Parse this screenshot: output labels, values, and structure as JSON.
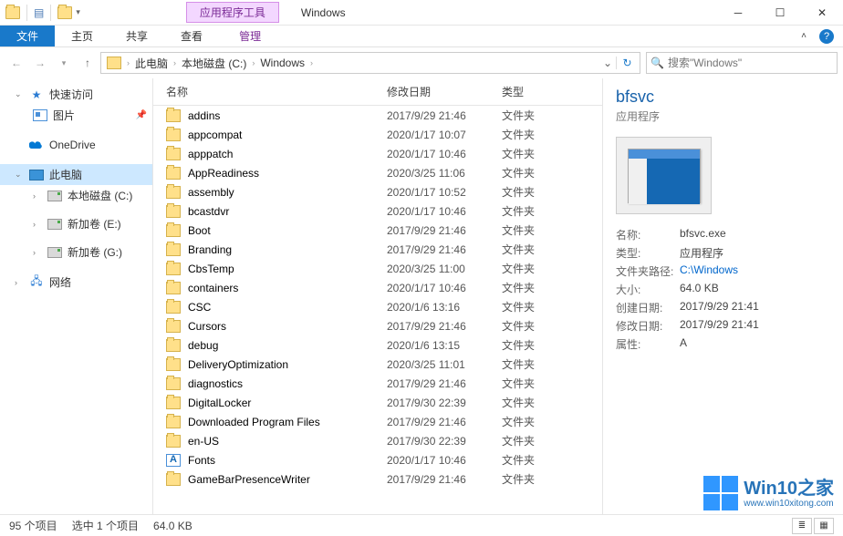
{
  "titlebar": {
    "tooltab": "应用程序工具",
    "title": "Windows"
  },
  "ribbon": {
    "file": "文件",
    "tabs": [
      "主页",
      "共享",
      "查看"
    ],
    "tooltab": "管理"
  },
  "breadcrumbs": [
    "此电脑",
    "本地磁盘 (C:)",
    "Windows"
  ],
  "search_placeholder": "搜索\"Windows\"",
  "sidebar": {
    "quick": "快速访问",
    "pictures": "图片",
    "onedrive": "OneDrive",
    "thispc": "此电脑",
    "drive_c": "本地磁盘 (C:)",
    "drive_e": "新加卷 (E:)",
    "drive_g": "新加卷 (G:)",
    "network": "网络"
  },
  "columns": {
    "name": "名称",
    "date": "修改日期",
    "type": "类型"
  },
  "files": [
    {
      "name": "addins",
      "date": "2017/9/29 21:46",
      "type": "文件夹",
      "icon": "folder"
    },
    {
      "name": "appcompat",
      "date": "2020/1/17 10:07",
      "type": "文件夹",
      "icon": "folder"
    },
    {
      "name": "apppatch",
      "date": "2020/1/17 10:46",
      "type": "文件夹",
      "icon": "folder"
    },
    {
      "name": "AppReadiness",
      "date": "2020/3/25 11:06",
      "type": "文件夹",
      "icon": "folder"
    },
    {
      "name": "assembly",
      "date": "2020/1/17 10:52",
      "type": "文件夹",
      "icon": "folder"
    },
    {
      "name": "bcastdvr",
      "date": "2020/1/17 10:46",
      "type": "文件夹",
      "icon": "folder"
    },
    {
      "name": "Boot",
      "date": "2017/9/29 21:46",
      "type": "文件夹",
      "icon": "folder"
    },
    {
      "name": "Branding",
      "date": "2017/9/29 21:46",
      "type": "文件夹",
      "icon": "folder"
    },
    {
      "name": "CbsTemp",
      "date": "2020/3/25 11:00",
      "type": "文件夹",
      "icon": "folder"
    },
    {
      "name": "containers",
      "date": "2020/1/17 10:46",
      "type": "文件夹",
      "icon": "folder"
    },
    {
      "name": "CSC",
      "date": "2020/1/6 13:16",
      "type": "文件夹",
      "icon": "folder"
    },
    {
      "name": "Cursors",
      "date": "2017/9/29 21:46",
      "type": "文件夹",
      "icon": "folder"
    },
    {
      "name": "debug",
      "date": "2020/1/6 13:15",
      "type": "文件夹",
      "icon": "folder"
    },
    {
      "name": "DeliveryOptimization",
      "date": "2020/3/25 11:01",
      "type": "文件夹",
      "icon": "folder"
    },
    {
      "name": "diagnostics",
      "date": "2017/9/29 21:46",
      "type": "文件夹",
      "icon": "folder"
    },
    {
      "name": "DigitalLocker",
      "date": "2017/9/30 22:39",
      "type": "文件夹",
      "icon": "folder"
    },
    {
      "name": "Downloaded Program Files",
      "date": "2017/9/29 21:46",
      "type": "文件夹",
      "icon": "folder"
    },
    {
      "name": "en-US",
      "date": "2017/9/30 22:39",
      "type": "文件夹",
      "icon": "folder"
    },
    {
      "name": "Fonts",
      "date": "2020/1/17 10:46",
      "type": "文件夹",
      "icon": "font"
    },
    {
      "name": "GameBarPresenceWriter",
      "date": "2017/9/29 21:46",
      "type": "文件夹",
      "icon": "folder"
    }
  ],
  "details": {
    "title": "bfsvc",
    "subtitle": "应用程序",
    "props": [
      {
        "k": "名称:",
        "v": "bfsvc.exe"
      },
      {
        "k": "类型:",
        "v": "应用程序"
      },
      {
        "k": "文件夹路径:",
        "v": "C:\\Windows",
        "link": true
      },
      {
        "k": "大小:",
        "v": "64.0 KB"
      },
      {
        "k": "创建日期:",
        "v": "2017/9/29 21:41"
      },
      {
        "k": "修改日期:",
        "v": "2017/9/29 21:41"
      },
      {
        "k": "属性:",
        "v": "A"
      }
    ]
  },
  "status": {
    "count": "95 个项目",
    "selected": "选中 1 个项目",
    "size": "64.0 KB"
  },
  "watermark": {
    "t1": "Win10之家",
    "t2": "www.win10xitong.com"
  }
}
